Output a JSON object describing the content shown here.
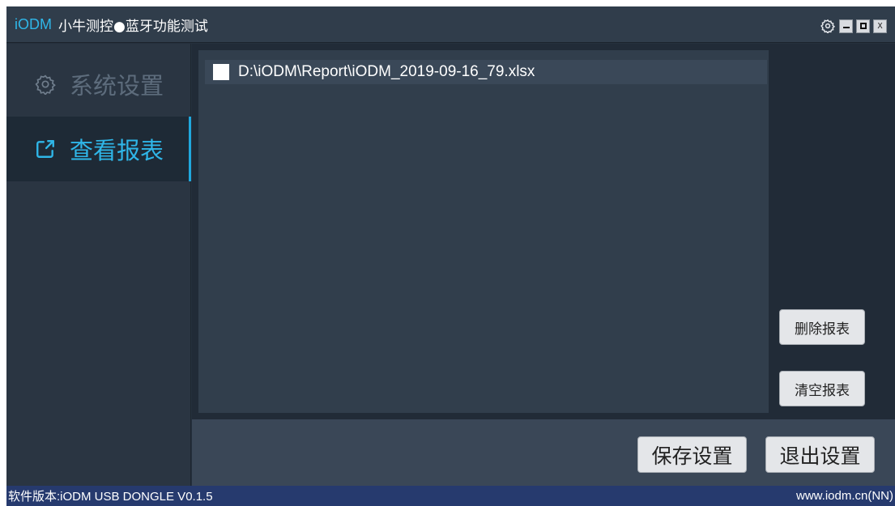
{
  "window": {
    "brand": "iODM",
    "title": "小牛测控●蓝牙功能测试",
    "controls": {
      "minimize": "minimize",
      "maximize": "maximize",
      "close": "X"
    }
  },
  "sidebar": {
    "items": [
      {
        "label": "系统设置",
        "icon": "gear-icon",
        "active": false
      },
      {
        "label": "查看报表",
        "icon": "export-icon",
        "active": true
      }
    ]
  },
  "reports": {
    "files": [
      {
        "name": "D:\\iODM\\Report\\iODM_2019-09-16_79.xlsx",
        "checked": false
      }
    ]
  },
  "actions": {
    "delete_label": "删除报表",
    "clear_label": "清空报表",
    "save_label": "保存设置",
    "exit_label": "退出设置"
  },
  "status": {
    "version": "软件版本:iODM USB DONGLE V0.1.5",
    "website": "www.iodm.cn(NN)"
  },
  "colors": {
    "accent": "#2fb6e8",
    "background": "#25303d",
    "statusbar": "#263a6e"
  }
}
